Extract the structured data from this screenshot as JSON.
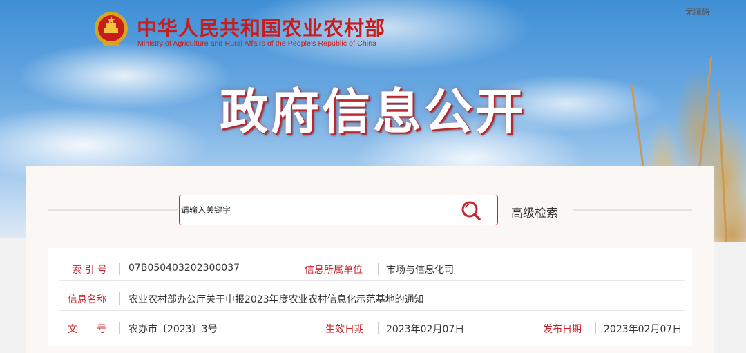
{
  "header": {
    "site_title": "中华人民共和国农业农村部",
    "site_subtitle": "Ministry of Agriculture and Rural Affairs of the People's Republic of China",
    "accessibility_link": "无障碍",
    "page_heading": "政府信息公开"
  },
  "search": {
    "placeholder": "请输入关键字",
    "advanced_label": "高级检索"
  },
  "info": {
    "index_label": "索 引 号",
    "index_value": "07B050403202300037",
    "unit_label": "信息所属单位",
    "unit_value": "市场与信息化司",
    "name_label": "信息名称",
    "name_value": "农业农村部办公厅关于申报2023年度农业农村信息化示范基地的通知",
    "doc_label": "文　　号",
    "doc_value": "农办市〔2023〕3号",
    "effective_label": "生效日期",
    "effective_value": "2023年02月07日",
    "publish_label": "发布日期",
    "publish_value": "2023年02月07日"
  },
  "colors": {
    "brand_red": "#c8242b",
    "sky_blue": "#3f8fd6"
  },
  "icons": {
    "emblem": "national-emblem-icon",
    "search": "search-icon"
  }
}
